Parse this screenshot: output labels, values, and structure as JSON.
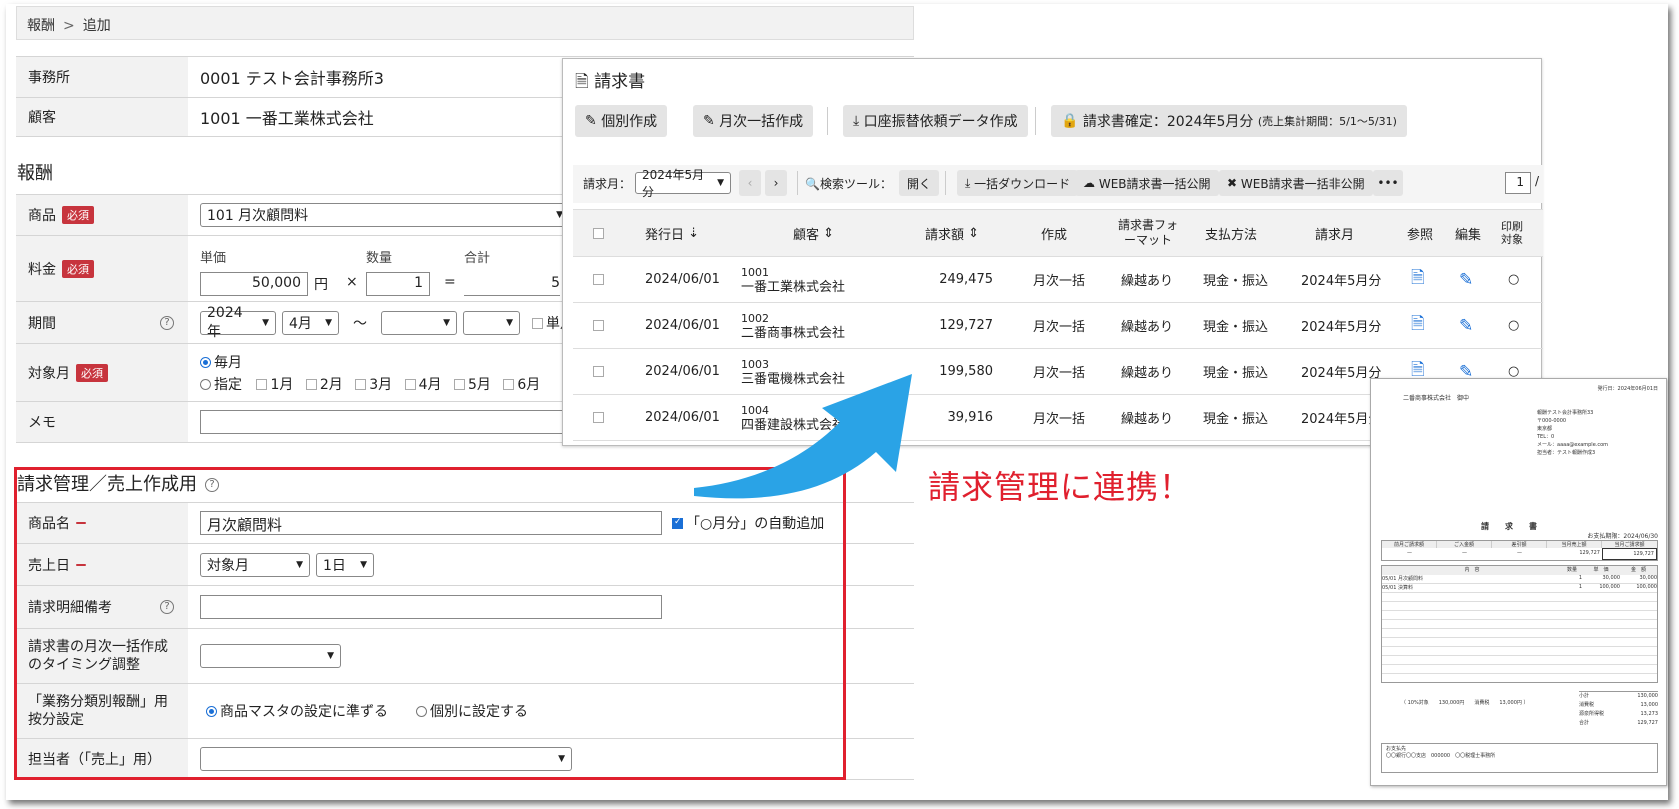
{
  "breadcrumb": {
    "parent": "報酬",
    "current": "追加"
  },
  "form": {
    "office_label": "事務所",
    "office_value": "0001  テスト会計事務所3",
    "client_label": "顧客",
    "client_value": "1001  一番工業株式会社",
    "section_title": "報酬",
    "required": "必須",
    "product_label": "商品",
    "product_value": "101 月次顧問料",
    "fee_label": "料金",
    "unit_price_label": "単価",
    "unit_price": "50,000",
    "yen": "円",
    "times": "×",
    "qty_label": "数量",
    "qty": "1",
    "equals": "=",
    "total_label": "合計",
    "total_partial": "5",
    "period_label": "期間",
    "period_year": "2024年",
    "period_month": "4月",
    "tilde": "〜",
    "single_partial": "単月",
    "target_label": "対象月",
    "target_monthly": "毎月",
    "target_specify": "指定",
    "months": [
      "1月",
      "2月",
      "3月",
      "4月",
      "5月",
      "6月"
    ],
    "memo_label": "メモ"
  },
  "mgmt": {
    "title": "請求管理／売上作成用",
    "item_name_label": "商品名",
    "item_name_value": "月次顧問料",
    "auto_add_label": "「○月分」の自動追加",
    "sales_date_label": "売上日",
    "sales_date_basis": "対象月",
    "sales_date_day": "1日",
    "detail_note_label": "請求明細備考",
    "timing_label": "請求書の月次一括作成のタイミング調整",
    "alloc_label": "「業務分類別報酬」用按分設定",
    "alloc_opt1": "商品マスタの設定に準ずる",
    "alloc_opt2": "個別に設定する",
    "staff_label": "担当者（「売上」用）"
  },
  "panel": {
    "title": "請求書",
    "btn_individual": "個別作成",
    "btn_monthly": "月次一括作成",
    "btn_transfer": "口座振替依頼データ作成",
    "btn_confirm": "請求書確定：2024年5月分",
    "confirm_note": "(売上集計期間：5/1〜5/31)",
    "month_label": "請求月：",
    "month_value": "2024年5月分",
    "search_label": "検索ツール：",
    "open_label": "開く",
    "dl_label": "一括ダウンロード",
    "web_pub": "WEB請求書一括公開",
    "web_unpub": "WEB請求書一括非公開",
    "more": "•••",
    "page": "1",
    "page_sep": "/",
    "headers": {
      "date": "発行日",
      "client": "顧客",
      "amount": "請求額",
      "create": "作成",
      "format": "請求書フォーマット",
      "pay": "支払方法",
      "month": "請求月",
      "ref": "参照",
      "edit": "編集",
      "print": "印刷対象"
    },
    "rows": [
      {
        "date": "2024/06/01",
        "code": "1001",
        "name": "一番工業株式会社",
        "amount": "249,475",
        "create": "月次一括",
        "format": "繰越あり",
        "pay": "現金・振込",
        "month": "2024年5月分"
      },
      {
        "date": "2024/06/01",
        "code": "1002",
        "name": "二番商事株式会社",
        "amount": "129,727",
        "create": "月次一括",
        "format": "繰越あり",
        "pay": "現金・振込",
        "month": "2024年5月分"
      },
      {
        "date": "2024/06/01",
        "code": "1003",
        "name": "三番電機株式会社",
        "amount": "199,580",
        "create": "月次一括",
        "format": "繰越あり",
        "pay": "現金・振込",
        "month": "2024年5月分"
      },
      {
        "date": "2024/06/01",
        "code": "1004",
        "name": "四番建設株式会社",
        "amount": "39,916",
        "create": "月次一括",
        "format": "繰越あり",
        "pay": "現金・振込",
        "month": "2024年5月分"
      }
    ]
  },
  "caption": "請求管理に連携！",
  "doc": {
    "issue": "発行日：2024年06月01日",
    "to": "二番商事株式会社　御中",
    "from": [
      "報酬テスト会計事務所33",
      "〒000-0000",
      "東京都",
      "TEL：0",
      "メール：aaaa@example.com",
      "担当者：テスト報酬作成3"
    ],
    "title": "請　　求　　書",
    "due": "お支払期限：2024/06/30",
    "summary_heads": [
      "前月ご請求額",
      "ご入金額",
      "差引額",
      "当月売上額",
      "当月ご請求額"
    ],
    "summary_vals": [
      "—",
      "—",
      "—",
      "129,727",
      "129,727"
    ],
    "item_heads": [
      "内　容",
      "数量",
      "単　価",
      "金　額"
    ],
    "items": [
      {
        "name": "05/01 月次顧問料",
        "qty": "1",
        "price": "30,000",
        "amount": "30,000"
      },
      {
        "name": "05/01 決算料",
        "qty": "1",
        "price": "100,000",
        "amount": "100,000"
      }
    ],
    "tax_line": "（ 10%対象　　130,000円　　消費税　　13,000円 ）",
    "totals": [
      [
        "小計",
        "130,000"
      ],
      [
        "消費税",
        "13,000"
      ],
      [
        "源泉所得税",
        "13,273"
      ],
      [
        "合計",
        "129,727"
      ]
    ],
    "bank_label": "お支払先",
    "bank": "〇〇銀行〇〇支店　000000　〇〇税理士事務所"
  }
}
